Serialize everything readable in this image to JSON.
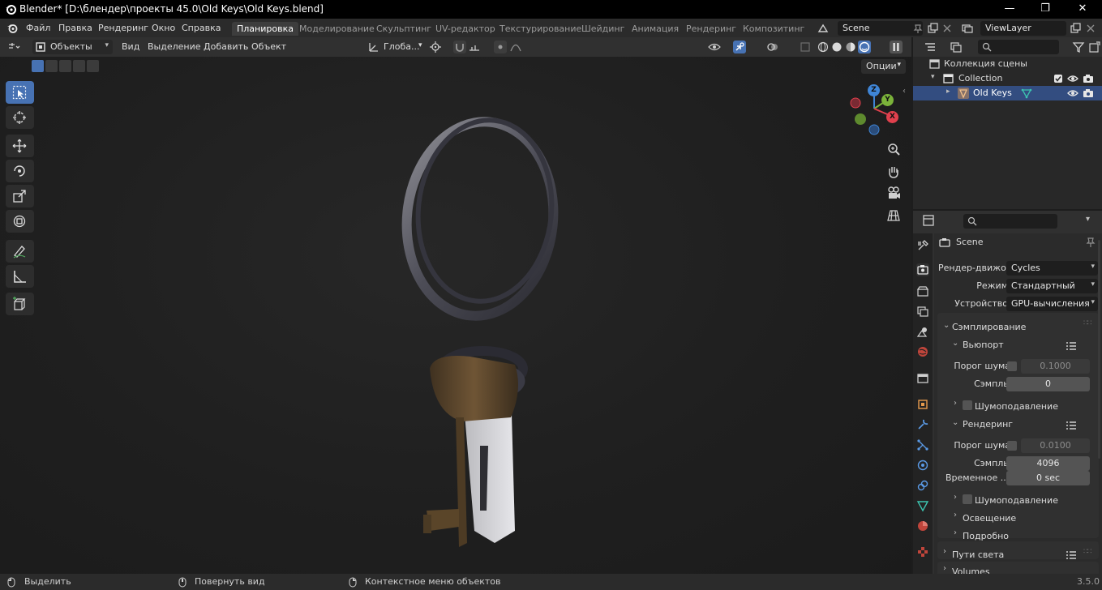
{
  "window": {
    "title": "Blender* [D:\\блендер\\проекты 45.0\\Old Keys\\Old Keys.blend]",
    "minimize": "—",
    "maximize": "❐",
    "close": "✕"
  },
  "menu": [
    "Файл",
    "Правка",
    "Рендеринг",
    "Окно",
    "Справка"
  ],
  "workspaces": [
    {
      "label": "Планировка",
      "active": true
    },
    {
      "label": "Моделирование",
      "active": false
    },
    {
      "label": "Скульптинг",
      "active": false
    },
    {
      "label": "UV-редактор",
      "active": false
    },
    {
      "label": "Текстурирование",
      "active": false
    },
    {
      "label": "Шейдинг",
      "active": false
    },
    {
      "label": "Анимация",
      "active": false
    },
    {
      "label": "Рендеринг",
      "active": false
    },
    {
      "label": "Композитинг",
      "active": false
    }
  ],
  "scene_name": "Scene",
  "view_layer": "ViewLayer",
  "viewport": {
    "mode": "Объекты",
    "menus": [
      "Вид",
      "Выделение",
      "Добавить",
      "Объект"
    ],
    "orientation": "Глоба...",
    "options_label": "Опции"
  },
  "outliner": {
    "search_placeholder": "",
    "rows": [
      {
        "label": "Коллекция сцены"
      },
      {
        "label": "Collection"
      },
      {
        "label": "Old Keys"
      }
    ]
  },
  "properties": {
    "context": "Scene",
    "render_engine_label": "Рендер-движок",
    "render_engine": "Cycles",
    "mode_label": "Режим",
    "mode": "Стандартный",
    "device_label": "Устройство",
    "device": "GPU-вычисления",
    "sampling": "Сэмплирование",
    "viewport_panel": "Вьюпорт",
    "noise_threshold_label": "Порог шума",
    "viewport_noise_threshold": "0.1000",
    "samples_label": "Сэмплы",
    "viewport_samples": "0",
    "denoise_label": "Шумоподавление",
    "render_panel": "Рендеринг",
    "render_noise_threshold": "0.0100",
    "render_samples": "4096",
    "time_limit_label": "Временное ...",
    "time_limit": "0 sec",
    "denoise_label_2": "Шумоподавление",
    "lighting": "Освещение",
    "advanced": "Подробно",
    "light_paths": "Пути света",
    "volumes": "Volumes"
  },
  "status": {
    "select": "Выделить",
    "rotate": "Повернуть вид",
    "context_menu": "Контекстное меню объектов",
    "version": "3.5.0"
  },
  "gizmo": {
    "z": "Z",
    "y": "Y",
    "x": "X"
  },
  "colors": {
    "accent": "#4772b3",
    "selection_row": "#334d80",
    "x_axis": "#e0404d",
    "y_axis": "#7bb33a",
    "z_axis": "#3f85d6"
  }
}
